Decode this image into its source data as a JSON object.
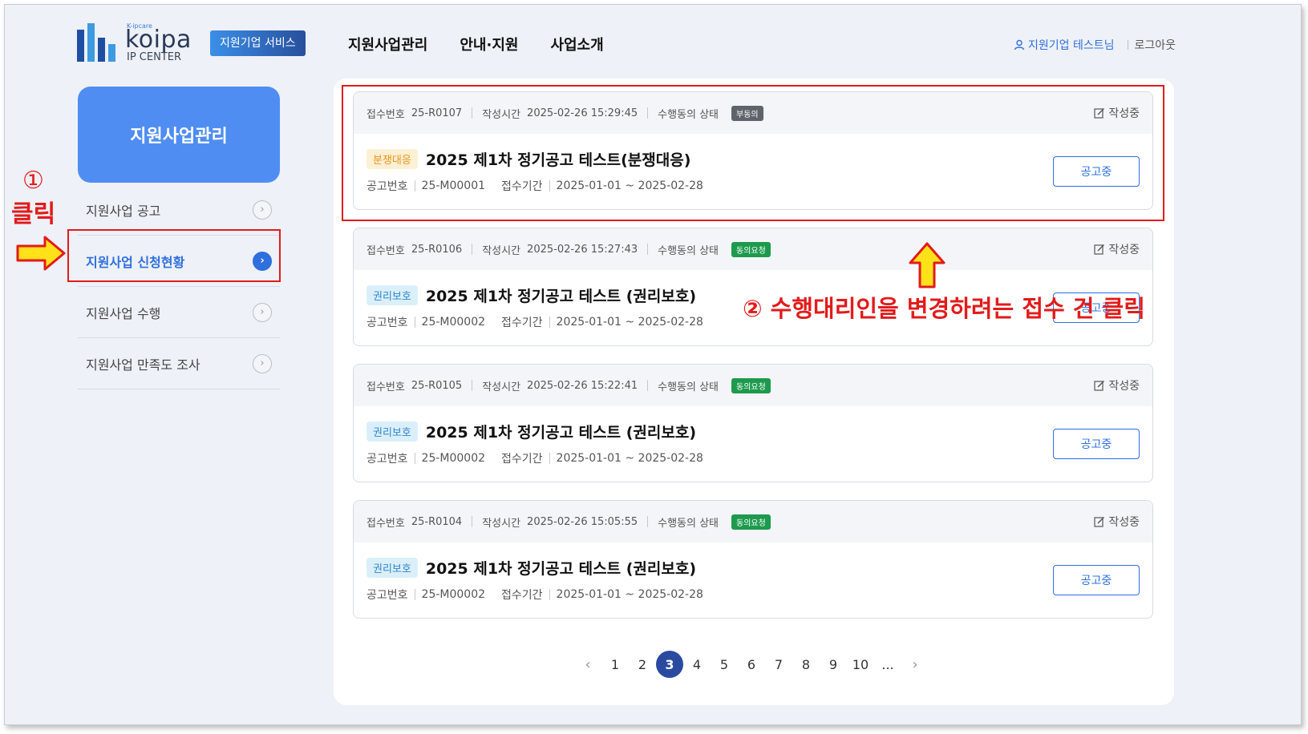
{
  "header": {
    "logo_sup": "K-ipcare",
    "logo_main": "koipa",
    "logo_sub": "IP CENTER",
    "service_badge": "지원기업 서비스",
    "nav": [
      "지원사업관리",
      "안내·지원",
      "사업소개"
    ],
    "user_name": "지원기업 테스트",
    "user_suffix": "님",
    "logout": "로그아웃"
  },
  "sidebar": {
    "title": "지원사업관리",
    "items": [
      {
        "label": "지원사업 공고"
      },
      {
        "label": "지원사업 신청현황"
      },
      {
        "label": "지원사업 수행"
      },
      {
        "label": "지원사업 만족도 조사"
      }
    ]
  },
  "labels": {
    "receipt_no": "접수번호",
    "created_time": "작성시간",
    "agreement_status": "수행동의 상태",
    "edit": "작성중",
    "notice_no": "공고번호",
    "receipt_period": "접수기간"
  },
  "cards": [
    {
      "receipt_no": "25-R0107",
      "created_time": "2025-02-26 15:29:45",
      "status": "부동의",
      "category": "분쟁대응",
      "title": "2025 제1차 정기공고 테스트(분쟁대응)",
      "notice_no": "25-M00001",
      "period": "2025-01-01 ~ 2025-02-28",
      "state": "공고중"
    },
    {
      "receipt_no": "25-R0106",
      "created_time": "2025-02-26 15:27:43",
      "status": "동의요청",
      "category": "권리보호",
      "title": "2025 제1차 정기공고 테스트 (권리보호)",
      "notice_no": "25-M00002",
      "period": "2025-01-01 ~ 2025-02-28",
      "state": "공고중"
    },
    {
      "receipt_no": "25-R0105",
      "created_time": "2025-02-26 15:22:41",
      "status": "동의요청",
      "category": "권리보호",
      "title": "2025 제1차 정기공고 테스트 (권리보호)",
      "notice_no": "25-M00002",
      "period": "2025-01-01 ~ 2025-02-28",
      "state": "공고중"
    },
    {
      "receipt_no": "25-R0104",
      "created_time": "2025-02-26 15:05:55",
      "status": "동의요청",
      "category": "권리보호",
      "title": "2025 제1차 정기공고 테스트 (권리보호)",
      "notice_no": "25-M00002",
      "period": "2025-01-01 ~ 2025-02-28",
      "state": "공고중"
    }
  ],
  "pagination": {
    "prev": "‹",
    "pages": [
      "1",
      "2",
      "3",
      "4",
      "5",
      "6",
      "7",
      "8",
      "9",
      "10",
      "..."
    ],
    "current": "3",
    "next": "›"
  },
  "annotations": {
    "step1_num": "①",
    "step1_text": "클릭",
    "step2_text": "② 수행대리인을 변경하려는 접수 건 클릭"
  },
  "colors": {
    "accent": "#2f6fde",
    "sidebar_title_bg": "#4f8df2",
    "annotation": "#e21b1b",
    "status_green": "#1d9a4d",
    "status_gray": "#5f646c"
  },
  "icons": {
    "user": "user-icon",
    "edit": "edit-icon",
    "chevron": "chevron-right-icon",
    "annotation_arrow": "arrow-icon"
  }
}
